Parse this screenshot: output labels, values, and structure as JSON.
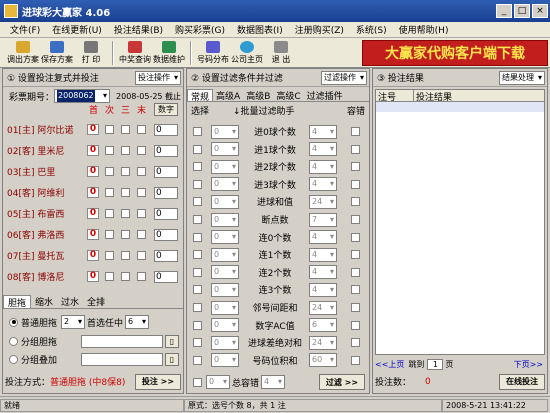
{
  "window": {
    "title": "进球彩大赢家 4.06"
  },
  "menu": [
    "文件(F)",
    "在线更新(U)",
    "投注结果(B)",
    "购买彩票(G)",
    "数据图表(I)",
    "注册购买(Z)",
    "系统(S)",
    "使用帮助(H)"
  ],
  "toolbar": [
    "调出方案",
    "保存方案",
    "打 印",
    "中奖查询",
    "数据维护",
    "号码分布",
    "公司主页",
    "退 出"
  ],
  "banner": "大赢家代购客户端下载",
  "left": {
    "title": "① 设置投注复式并投注",
    "op": "投注操作",
    "issue_label": "彩票期号：",
    "issue": "2008062",
    "date": "2008-05-25 截止",
    "cols": [
      "首",
      "次",
      "三",
      "末",
      "数字"
    ],
    "teams": [
      {
        "n": "01[主] 阿尔比诺",
        "v": "0"
      },
      {
        "n": "02[客] 里米尼",
        "v": "0"
      },
      {
        "n": "03[主] 巴里",
        "v": "0"
      },
      {
        "n": "04[客] 阿维利",
        "v": "0"
      },
      {
        "n": "05[主] 布雷西",
        "v": "0"
      },
      {
        "n": "06[客] 弗洛西",
        "v": "0"
      },
      {
        "n": "07[主] 曼托瓦",
        "v": "0"
      },
      {
        "n": "08[客] 博洛尼",
        "v": "0"
      }
    ],
    "tabs": [
      "胆拖",
      "缩水",
      "过水",
      "全排"
    ],
    "opt1": "普通胆拖",
    "sel1": "2",
    "mid": "首选任中",
    "sel2": "6",
    "opt2": "分组胆拖",
    "opt3": "分组叠加",
    "method_label": "投注方式：",
    "method": "普通胆拖 (中8保8)",
    "bet": "投注 >>"
  },
  "mid": {
    "title": "② 设置过滤条件并过滤",
    "op": "过滤操作",
    "tabs": [
      "常规",
      "高级A",
      "高级B",
      "高级C",
      "过滤插件"
    ],
    "h1": "选择",
    "h2": "↓批量过滤助手",
    "h3": "容错",
    "rows": [
      {
        "a": "0",
        "b": "进0球个数",
        "c": "4"
      },
      {
        "a": "0",
        "b": "进1球个数",
        "c": "4"
      },
      {
        "a": "0",
        "b": "进2球个数",
        "c": "4"
      },
      {
        "a": "0",
        "b": "进3球个数",
        "c": "4"
      },
      {
        "a": "0",
        "b": "进球和值",
        "c": "24"
      },
      {
        "a": "0",
        "b": "断点数",
        "c": "7"
      },
      {
        "a": "0",
        "b": "连0个数",
        "c": "4"
      },
      {
        "a": "0",
        "b": "连1个数",
        "c": "4"
      },
      {
        "a": "0",
        "b": "连2个数",
        "c": "4"
      },
      {
        "a": "0",
        "b": "连3个数",
        "c": "4"
      },
      {
        "a": "0",
        "b": "邻号间距和",
        "c": "24"
      },
      {
        "a": "0",
        "b": "数字AC值",
        "c": "6"
      },
      {
        "a": "0",
        "b": "进球差绝对和",
        "c": "24"
      },
      {
        "a": "0",
        "b": "号码位积和",
        "c": "60"
      }
    ],
    "tol_label": "总容错",
    "tol": "4",
    "filter": "过滤 >>"
  },
  "right": {
    "title": "③ 投注结果",
    "op": "结果处理",
    "c1": "注号",
    "c2": "投注结果",
    "nav": [
      "<<上页",
      "跳到",
      "1",
      "页",
      "下页>>"
    ],
    "count_label": "投注数：",
    "count": "0",
    "online": "在线投注"
  },
  "status": {
    "s1": "就绪",
    "s2": "原式：选号个数 8，共 1 注",
    "s3": "2008-5-21  13:41:22"
  }
}
